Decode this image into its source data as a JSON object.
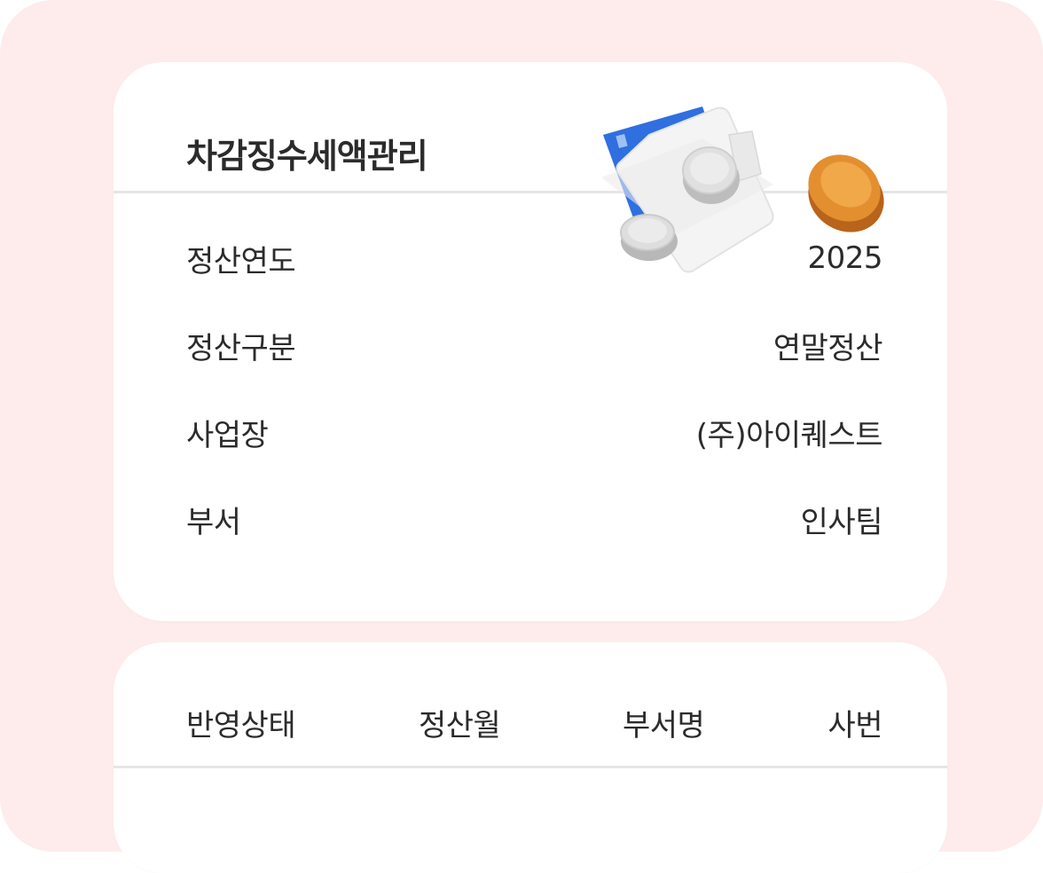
{
  "info_card": {
    "title": "차감징수세액관리",
    "rows": [
      {
        "label": "정산연도",
        "value": "2025"
      },
      {
        "label": "정산구분",
        "value": "연말정산"
      },
      {
        "label": "사업장",
        "value": "(주)아이퀘스트"
      },
      {
        "label": "부서",
        "value": "인사팀"
      }
    ]
  },
  "list_card": {
    "columns": [
      "반영상태",
      "정산월",
      "부서명",
      "사번"
    ]
  },
  "illustration": {
    "name": "wallet-coins-illustration",
    "colors": {
      "card": "#2f6fe0",
      "wallet": "#f2f2f2",
      "coin_silver": "#d9d9d9",
      "coin_gold": "#e08a2a"
    }
  },
  "colors": {
    "background": "#fdeceb",
    "card": "#ffffff",
    "divider": "#e6e6e6",
    "text": "#2b2b2b"
  }
}
